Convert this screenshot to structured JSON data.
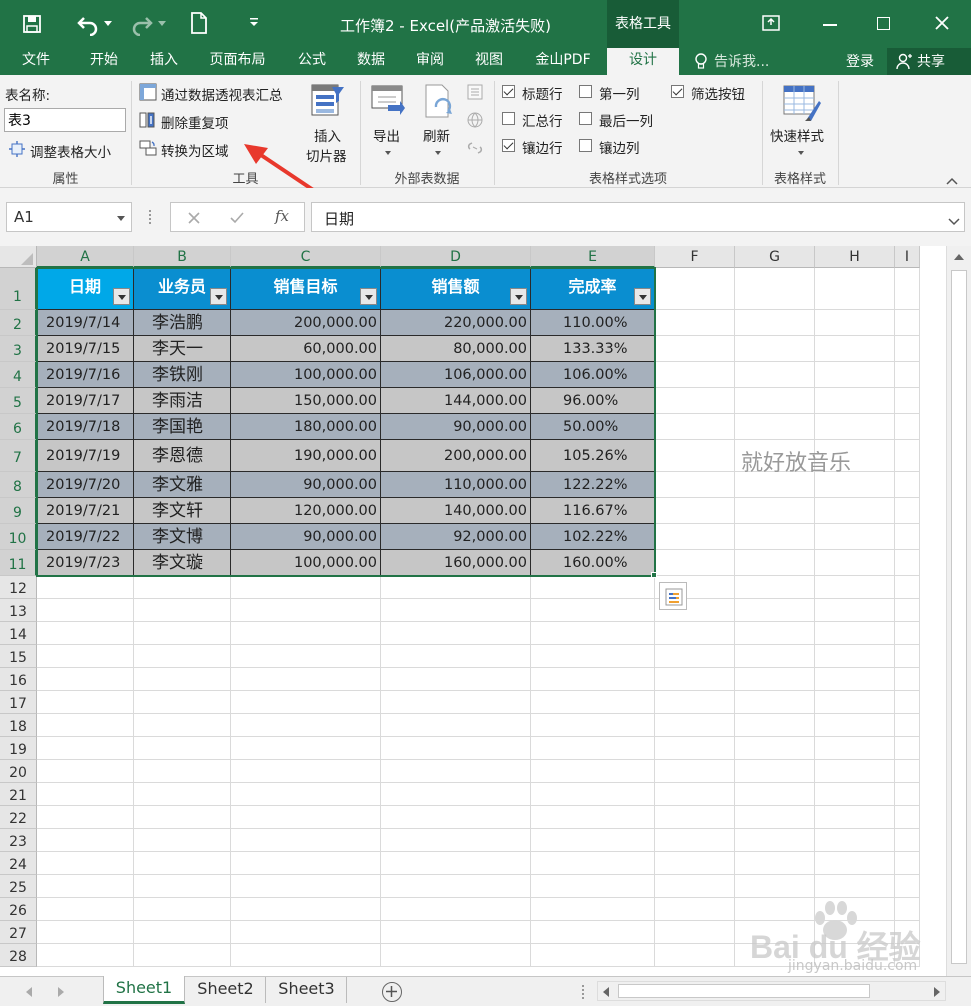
{
  "titlebar": {
    "title": "工作簿2 - Excel(产品激活失败)",
    "context_tab": "表格工具",
    "login": "登录",
    "share": "共享"
  },
  "tabs": [
    "文件",
    "开始",
    "插入",
    "页面布局",
    "公式",
    "数据",
    "审阅",
    "视图",
    "金山PDF",
    "设计"
  ],
  "tellme": "告诉我...",
  "ribbon": {
    "properties": {
      "label": "属性",
      "table_name_label": "表名称:",
      "table_name_value": "表3",
      "resize": "调整表格大小"
    },
    "tools": {
      "label": "工具",
      "pivot": "通过数据透视表汇总",
      "remove_dup": "删除重复项",
      "convert": "转换为区域",
      "slicer_line1": "插入",
      "slicer_line2": "切片器"
    },
    "external": {
      "label": "外部表数据",
      "export": "导出",
      "refresh": "刷新"
    },
    "style_options": {
      "label": "表格样式选项",
      "header_row": "标题行",
      "total_row": "汇总行",
      "banded_rows": "镶边行",
      "first_col": "第一列",
      "last_col": "最后一列",
      "banded_cols": "镶边列",
      "filter_btn": "筛选按钮"
    },
    "styles": {
      "label": "表格样式",
      "quick": "快速样式"
    }
  },
  "formula_bar": {
    "name_box": "A1",
    "content": "日期",
    "fx": "fx"
  },
  "columns": [
    "A",
    "B",
    "C",
    "D",
    "E",
    "F",
    "G",
    "H",
    "I"
  ],
  "rows": [
    "1",
    "2",
    "3",
    "4",
    "5",
    "6",
    "7",
    "8",
    "9",
    "10",
    "11",
    "12",
    "13",
    "14",
    "15",
    "16",
    "17",
    "18",
    "19",
    "20",
    "21",
    "22",
    "23",
    "24",
    "25",
    "26",
    "27",
    "28"
  ],
  "table": {
    "headers": [
      "日期",
      "业务员",
      "销售目标",
      "销售额",
      "完成率"
    ],
    "rows": [
      [
        "2019/7/14",
        "李浩鹏",
        "200,000.00",
        "220,000.00",
        "110.00%"
      ],
      [
        "2019/7/15",
        "李天一",
        "60,000.00",
        "80,000.00",
        "133.33%"
      ],
      [
        "2019/7/16",
        "李铁刚",
        "100,000.00",
        "106,000.00",
        "106.00%"
      ],
      [
        "2019/7/17",
        "李雨洁",
        "150,000.00",
        "144,000.00",
        "96.00%"
      ],
      [
        "2019/7/18",
        "李国艳",
        "180,000.00",
        "90,000.00",
        "50.00%"
      ],
      [
        "2019/7/19",
        "李恩德",
        "190,000.00",
        "200,000.00",
        "105.26%"
      ],
      [
        "2019/7/20",
        "李文雅",
        "90,000.00",
        "110,000.00",
        "122.22%"
      ],
      [
        "2019/7/21",
        "李文轩",
        "120,000.00",
        "140,000.00",
        "116.67%"
      ],
      [
        "2019/7/22",
        "李文博",
        "90,000.00",
        "92,000.00",
        "102.22%"
      ],
      [
        "2019/7/23",
        "李文璇",
        "100,000.00",
        "160,000.00",
        "160.00%"
      ]
    ]
  },
  "annotation": "就好放音乐",
  "sheets": [
    "Sheet1",
    "Sheet2",
    "Sheet3"
  ],
  "watermark": {
    "line1": "Bai du 经验",
    "line2": "jingyan.baidu.com"
  },
  "colors": {
    "excel_green": "#217346",
    "header_blue": "#0a8ed0",
    "band_dark": "#a6b0bc",
    "band_light": "#c6c6c6",
    "arrow_red": "#e8382c"
  }
}
